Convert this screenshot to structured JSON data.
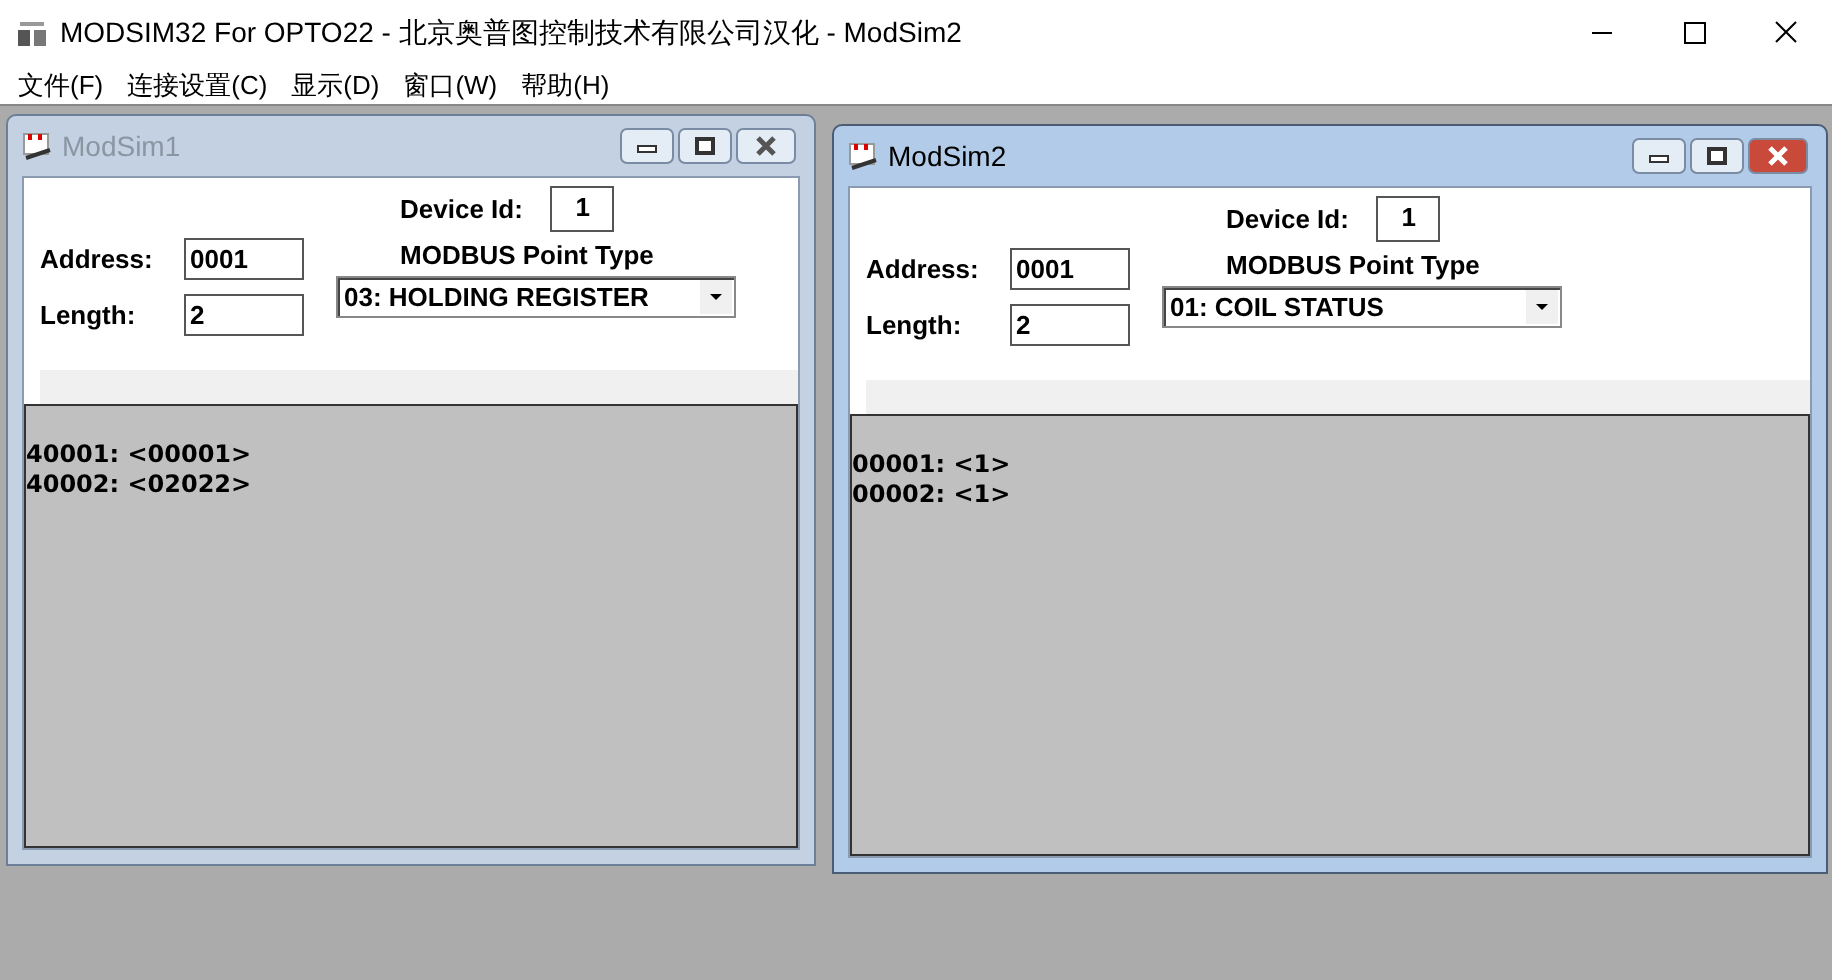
{
  "window": {
    "title": "MODSIM32 For OPTO22 - 北京奥普图控制技术有限公司汉化 - ModSim2"
  },
  "menu": [
    "文件(F)",
    "连接设置(C)",
    "显示(D)",
    "窗口(W)",
    "帮助(H)"
  ],
  "child_windows": [
    {
      "title": "ModSim1",
      "active": false,
      "device_id_label": "Device Id:",
      "device_id": "1",
      "address_label": "Address:",
      "address": "0001",
      "length_label": "Length:",
      "length": "2",
      "point_type_label": "MODBUS Point Type",
      "point_type": "03: HOLDING REGISTER",
      "registers": [
        "40001: <00001>",
        "40002: <02022>"
      ]
    },
    {
      "title": "ModSim2",
      "active": true,
      "device_id_label": "Device Id:",
      "device_id": "1",
      "address_label": "Address:",
      "address": "0001",
      "length_label": "Length:",
      "length": "2",
      "point_type_label": "MODBUS Point Type",
      "point_type": "01: COIL STATUS",
      "registers": [
        "00001: <1>",
        "00002: <1>"
      ]
    }
  ]
}
